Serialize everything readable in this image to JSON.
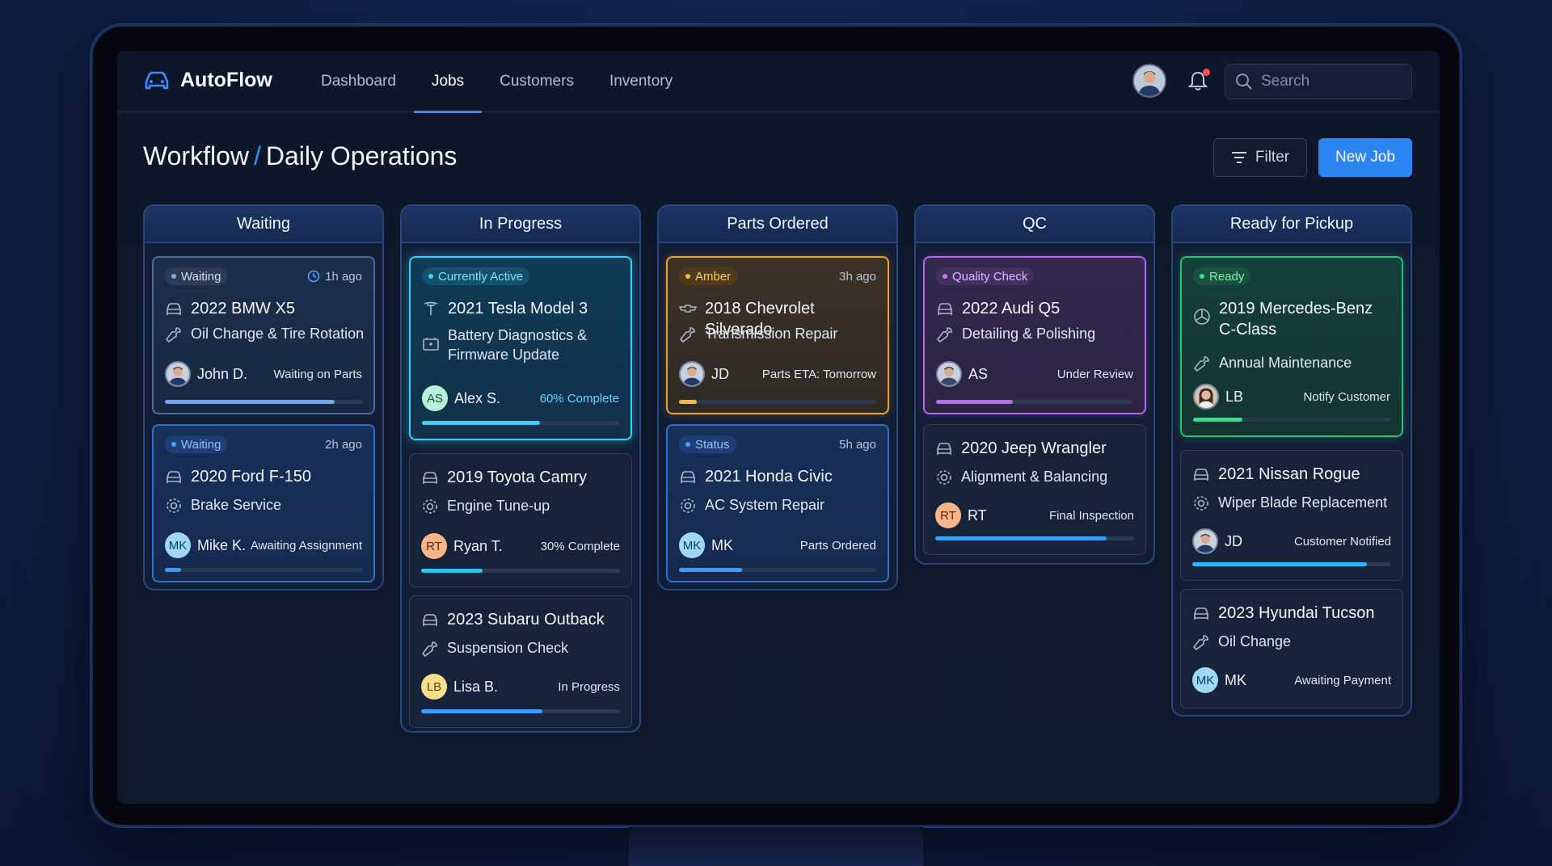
{
  "app": {
    "name": "AutoFlow"
  },
  "nav": {
    "links": [
      "Dashboard",
      "Jobs",
      "Customers",
      "Inventory"
    ],
    "active": "Jobs",
    "search_placeholder": "Search",
    "has_notification": true
  },
  "header": {
    "breadcrumb_root": "Workflow",
    "separator": "/",
    "title": "Daily Operations",
    "filter_label": "Filter",
    "new_job_label": "New Job"
  },
  "colors": {
    "accent": "#2b86f2",
    "waiting": "#4c6a96",
    "active": "#35d0ff",
    "amber": "#f0a022",
    "qc": "#b562f0",
    "ready": "#22c578"
  },
  "columns": [
    {
      "title": "Waiting",
      "cards": [
        {
          "badge": "Waiting",
          "time": "1h ago",
          "time_icon": "clock-icon",
          "vehicle": "2022 BMW X5",
          "vehicle_icon": "car-icon",
          "service": "Oil Change & Tire Rotation",
          "service_icon": "wrench-icon",
          "assignee": "John D.",
          "avatar": "photo",
          "status": "Waiting on Parts",
          "progress": 0.86
        },
        {
          "badge": "Waiting",
          "time": "2h ago",
          "vehicle": "2020 Ford F-150",
          "vehicle_icon": "car-icon",
          "service": "Brake Service",
          "service_icon": "gear-icon",
          "assignee": "Mike K.",
          "avatar": "MK",
          "status": "Awaiting Assignment",
          "progress": 0.08
        }
      ]
    },
    {
      "title": "In Progress",
      "cards": [
        {
          "badge": "Currently Active",
          "vehicle": "2021 Tesla Model 3",
          "vehicle_icon": "tesla-logo-icon",
          "service": "Battery Diagnostics & Firmware Update",
          "service_icon": "battery-icon",
          "assignee": "Alex S.",
          "avatar": "AS",
          "status": "60% Complete",
          "progress": 0.6
        },
        {
          "vehicle": "2019 Toyota Camry",
          "vehicle_icon": "car-icon",
          "service": "Engine Tune-up",
          "service_icon": "gear-icon",
          "assignee": "Ryan T.",
          "avatar": "RT",
          "status": "30% Complete",
          "progress": 0.31
        },
        {
          "vehicle": "2023 Subaru Outback",
          "vehicle_icon": "car-icon",
          "service": "Suspension Check",
          "service_icon": "wrench-icon",
          "assignee": "Lisa B.",
          "avatar": "LB",
          "status": "In Progress",
          "progress": 0.61
        }
      ]
    },
    {
      "title": "Parts Ordered",
      "cards": [
        {
          "badge": "Amber",
          "time": "3h ago",
          "vehicle": "2018 Chevrolet Silverado",
          "vehicle_icon": "chevrolet-logo-icon",
          "service": "Transmission Repair",
          "service_icon": "wrench-icon",
          "assignee": "JD",
          "avatar": "photo",
          "status": "Parts ETA: Tomorrow",
          "progress": 0.09
        },
        {
          "badge": "Status",
          "time": "5h ago",
          "vehicle": "2021 Honda Civic",
          "vehicle_icon": "car-icon",
          "service": "AC System Repair",
          "service_icon": "gear-icon",
          "assignee": "MK",
          "avatar": "MK",
          "status": "Parts Ordered",
          "progress": 0.32
        }
      ]
    },
    {
      "title": "QC",
      "cards": [
        {
          "badge": "Quality Check",
          "vehicle": "2022 Audi Q5",
          "vehicle_icon": "car-icon",
          "service": "Detailing & Polishing",
          "service_icon": "wrench-icon",
          "assignee": "AS",
          "avatar": "photo",
          "status": "Under Review",
          "progress": 0.39
        },
        {
          "vehicle": "2020 Jeep Wrangler",
          "vehicle_icon": "car-icon",
          "service": "Alignment & Balancing",
          "service_icon": "gear-icon",
          "assignee": "RT",
          "avatar": "RT",
          "status": "Final Inspection",
          "progress": 0.86
        }
      ]
    },
    {
      "title": "Ready for Pickup",
      "cards": [
        {
          "badge": "Ready",
          "vehicle": "2019 Mercedes-Benz C-Class",
          "vehicle_icon": "mercedes-logo-icon",
          "service": "Annual Maintenance",
          "service_icon": "wrench-icon",
          "assignee": "LB",
          "avatar": "photo",
          "status": "Notify Customer",
          "progress": 0.25
        },
        {
          "vehicle": "2021 Nissan Rogue",
          "vehicle_icon": "car-icon",
          "service": "Wiper Blade Replacement",
          "service_icon": "gear-icon",
          "assignee": "JD",
          "avatar": "photo",
          "status": "Customer Notified",
          "progress": 0.88
        },
        {
          "vehicle": "2023 Hyundai Tucson",
          "vehicle_icon": "car-icon",
          "service": "Oil Change",
          "service_icon": "wrench-icon",
          "assignee": "MK",
          "avatar": "MK",
          "status": "Awaiting Payment",
          "progress": null
        }
      ]
    }
  ]
}
